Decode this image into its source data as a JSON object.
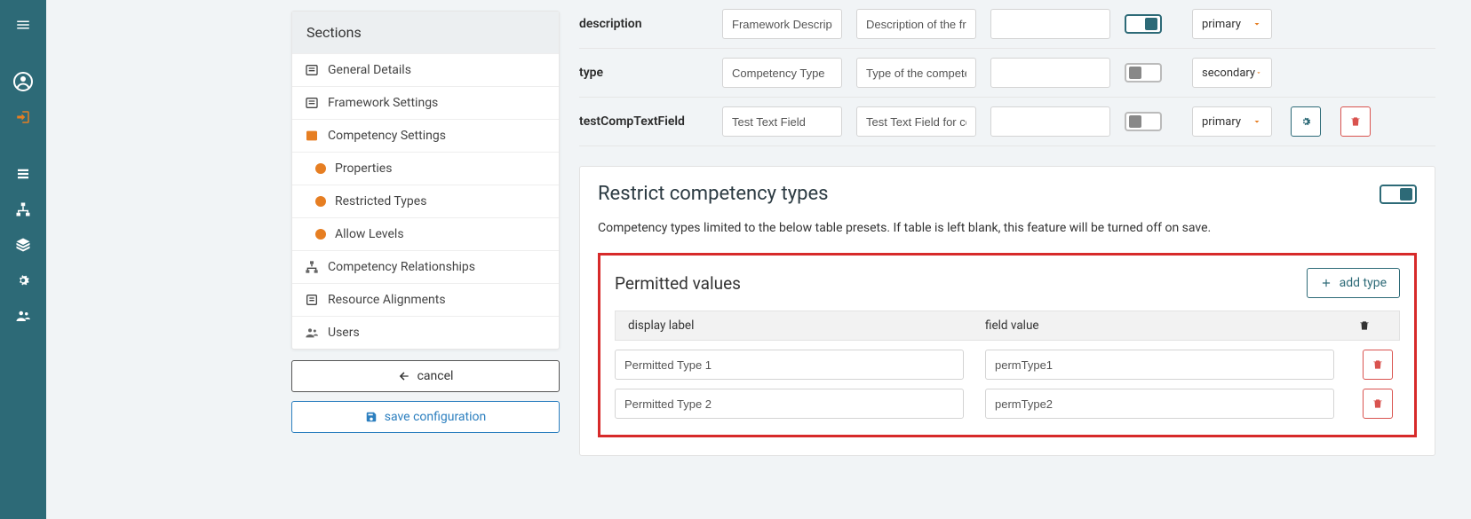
{
  "sidebar": {
    "header": "Sections",
    "items": [
      {
        "label": "General Details"
      },
      {
        "label": "Framework Settings"
      },
      {
        "label": "Competency Settings"
      },
      {
        "label": "Properties"
      },
      {
        "label": "Restricted Types"
      },
      {
        "label": "Allow Levels"
      },
      {
        "label": "Competency Relationships"
      },
      {
        "label": "Resource Alignments"
      },
      {
        "label": "Users"
      }
    ],
    "cancel_label": "cancel",
    "save_label": "save configuration"
  },
  "fields": {
    "rows": [
      {
        "key": "description",
        "label_value": "Framework Description",
        "desc_value": "Description of the framework",
        "priority": "primary",
        "toggle_on": true,
        "show_actions": false
      },
      {
        "key": "type",
        "label_value": "Competency Type",
        "desc_value": "Type of the competency",
        "priority": "secondary",
        "toggle_on": false,
        "show_actions": false
      },
      {
        "key": "testCompTextField",
        "label_value": "Test Text Field",
        "desc_value": "Test Text Field for competency",
        "priority": "primary",
        "toggle_on": false,
        "show_actions": true
      }
    ]
  },
  "restrict": {
    "title": "Restrict competency types",
    "desc": "Competency types limited to the below table presets. If table is left blank, this feature will be turned off on save.",
    "toggle_on": true
  },
  "permitted": {
    "title": "Permitted values",
    "add_label": "add type",
    "head_display": "display label",
    "head_value": "field value",
    "rows": [
      {
        "display": "Permitted Type 1",
        "value": "permType1"
      },
      {
        "display": "Permitted Type 2",
        "value": "permType2"
      }
    ]
  }
}
